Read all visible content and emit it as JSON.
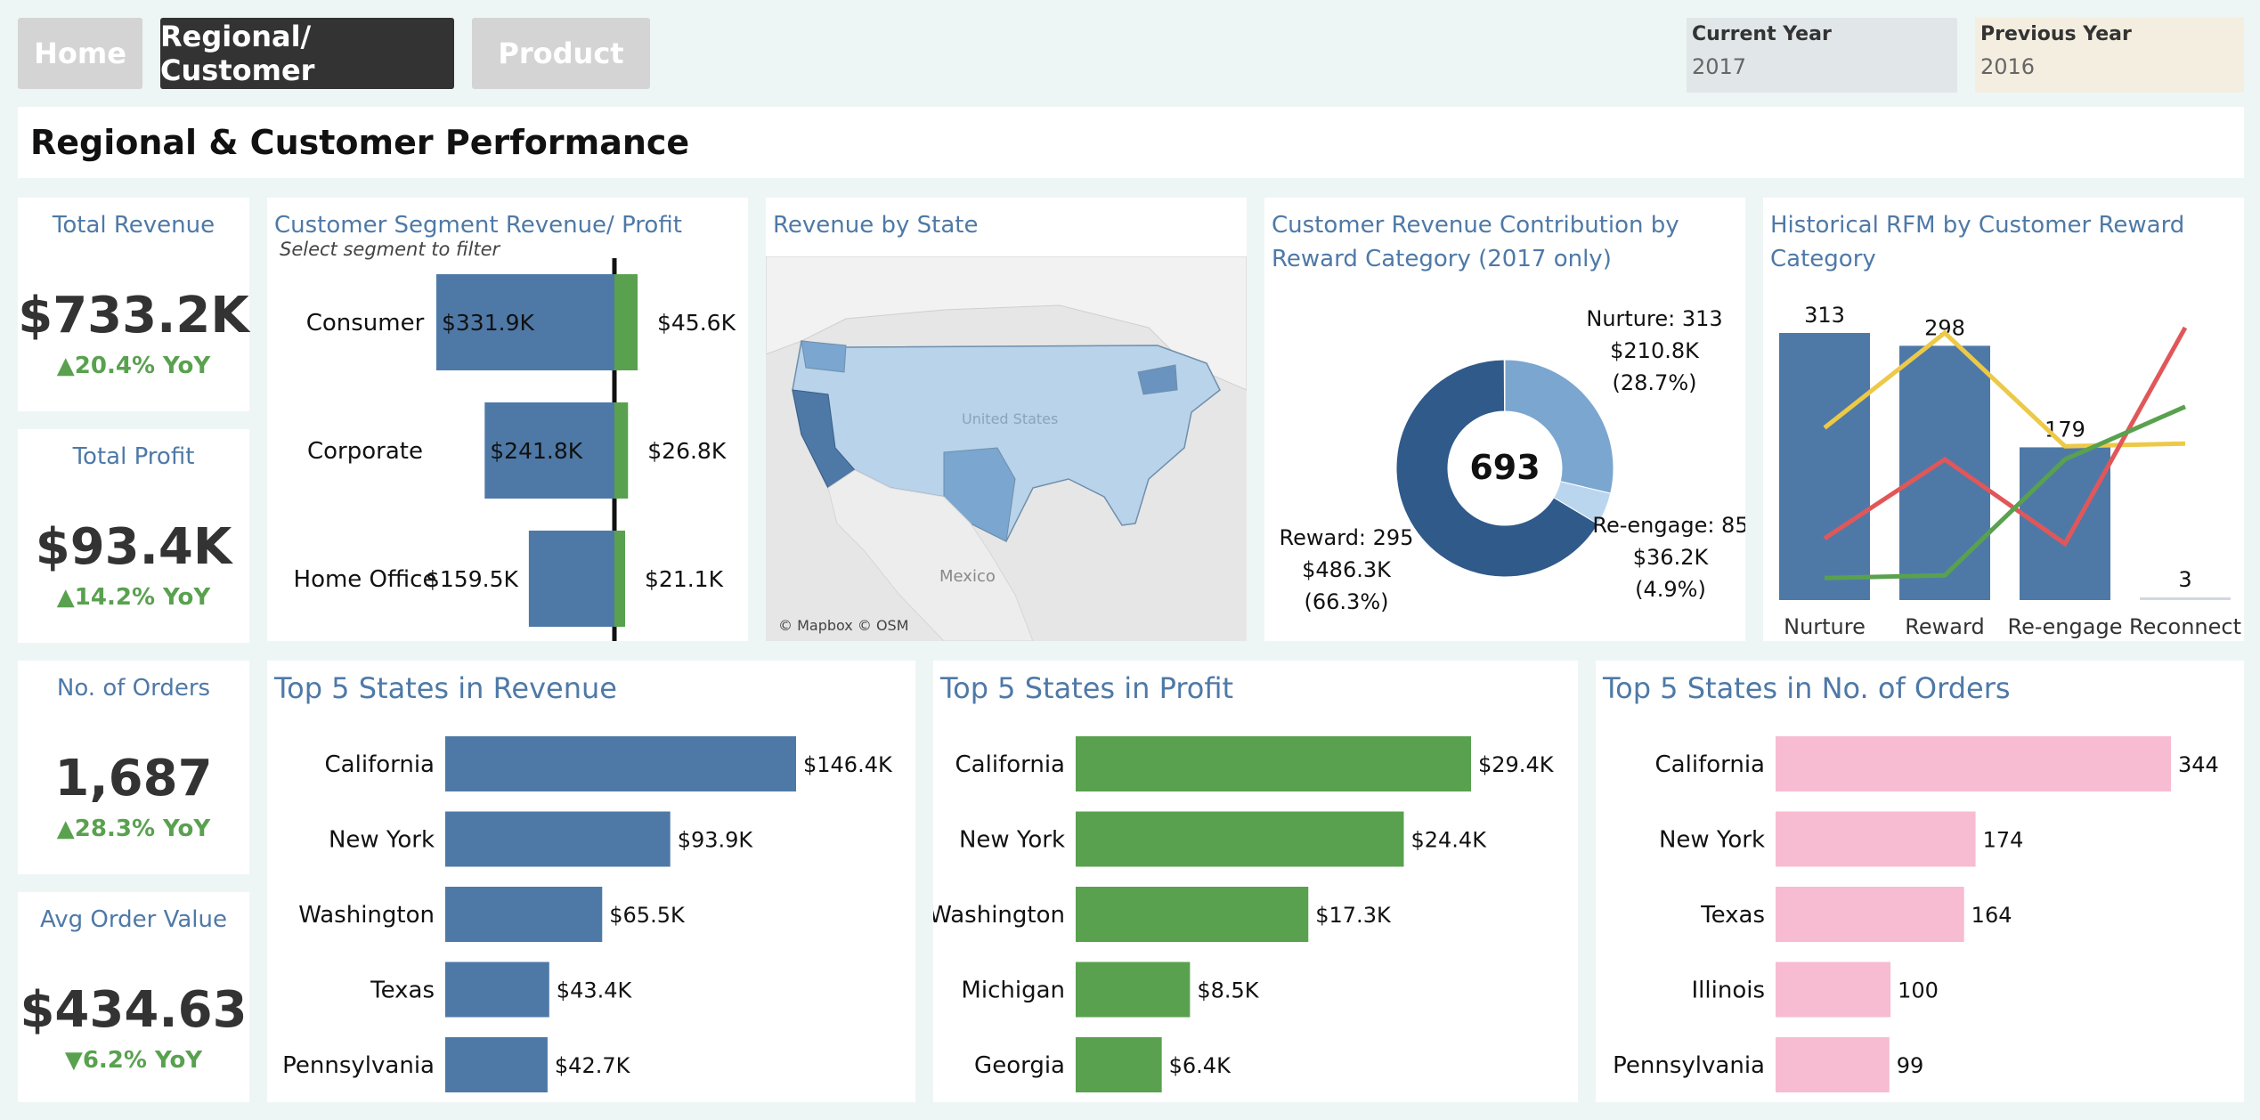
{
  "tabs": [
    {
      "label": "Home"
    },
    {
      "label": "Regional/ Customer"
    },
    {
      "label": "Product"
    }
  ],
  "filters": {
    "current_year": {
      "label": "Current Year",
      "value": "2017",
      "color": "#e1e6e8"
    },
    "previous_year": {
      "label": "Previous Year",
      "value": "2016",
      "color": "#f4eee0"
    }
  },
  "page_title": "Regional & Customer Performance",
  "kpis": {
    "revenue": {
      "title": "Total Revenue",
      "value": "$733.2K",
      "yoy": "▲20.4% YoY"
    },
    "profit": {
      "title": "Total Profit",
      "value": "$93.4K",
      "yoy": "▲14.2% YoY"
    },
    "orders": {
      "title": "No. of Orders",
      "value": "1,687",
      "yoy": "▲28.3% YoY"
    },
    "aov": {
      "title": "Avg Order Value",
      "value": "$434.63",
      "yoy": "▼6.2% YoY"
    }
  },
  "colors": {
    "blue": "#4e79a7",
    "green": "#59a14f",
    "pink": "#f7bcd1",
    "title_blue": "#4e79a7"
  },
  "segment": {
    "title": "Customer Segment Revenue/ Profit",
    "subtitle": "Select segment to filter",
    "rows": [
      {
        "name": "Consumer",
        "revenue_label": "$331.9K",
        "revenue": 331.9,
        "profit_label": "$45.6K",
        "profit": 45.6
      },
      {
        "name": "Corporate",
        "revenue_label": "$241.8K",
        "revenue": 241.8,
        "profit_label": "$26.8K",
        "profit": 26.8
      },
      {
        "name": "Home Office",
        "revenue_label": "$159.5K",
        "revenue": 159.5,
        "profit_label": "$21.1K",
        "profit": 21.1
      }
    ]
  },
  "map": {
    "title": "Revenue by State",
    "credit": "© Mapbox © OSM",
    "country_label": "Mexico",
    "us_label": "United States"
  },
  "donut": {
    "title_line1": "Customer Revenue Contribution by",
    "title_line2": "Reward Category (2017 only)",
    "center": "693",
    "slices": [
      {
        "name": "Nurture",
        "count": 313,
        "revenue": "$210.8K",
        "pct": 28.7,
        "pct_label": "(28.7%)",
        "label": "Nurture: 313",
        "color": "#7aa6d0"
      },
      {
        "name": "Re-engage",
        "count": 85,
        "revenue": "$36.2K",
        "pct": 4.9,
        "pct_label": "(4.9%)",
        "label": "Re-engage: 85",
        "color": "#b9d6ee"
      },
      {
        "name": "Reward",
        "count": 295,
        "revenue": "$486.3K",
        "pct": 66.3,
        "pct_label": "(66.3%)",
        "label": "Reward: 295",
        "color": "#2f5a8a"
      }
    ]
  },
  "rfm": {
    "title_line1": "Historical RFM by Customer Reward",
    "title_line2": "Category",
    "categories": [
      "Nurture",
      "Reward",
      "Re-engage",
      "Reconnect"
    ],
    "bars": [
      313,
      298,
      179,
      3
    ],
    "lines": [
      {
        "color": "#edc948",
        "values": [
          0.62,
          0.98,
          0.55,
          0.56
        ]
      },
      {
        "color": "#e15759",
        "values": [
          0.2,
          0.5,
          0.18,
          1.0
        ]
      },
      {
        "color": "#59a14f",
        "values": [
          0.05,
          0.06,
          0.5,
          0.7
        ]
      }
    ]
  },
  "top_revenue": {
    "title": "Top 5 States in Revenue",
    "rows": [
      {
        "state": "California",
        "value": 146.4,
        "label": "$146.4K"
      },
      {
        "state": "New York",
        "value": 93.9,
        "label": "$93.9K"
      },
      {
        "state": "Washington",
        "value": 65.5,
        "label": "$65.5K"
      },
      {
        "state": "Texas",
        "value": 43.4,
        "label": "$43.4K"
      },
      {
        "state": "Pennsylvania",
        "value": 42.7,
        "label": "$42.7K"
      }
    ]
  },
  "top_profit": {
    "title": "Top 5 States in Profit",
    "rows": [
      {
        "state": "California",
        "value": 29.4,
        "label": "$29.4K"
      },
      {
        "state": "New York",
        "value": 24.4,
        "label": "$24.4K"
      },
      {
        "state": "Washington",
        "value": 17.3,
        "label": "$17.3K"
      },
      {
        "state": "Michigan",
        "value": 8.5,
        "label": "$8.5K"
      },
      {
        "state": "Georgia",
        "value": 6.4,
        "label": "$6.4K"
      }
    ]
  },
  "top_orders": {
    "title": "Top 5 States in No. of Orders",
    "rows": [
      {
        "state": "California",
        "value": 344,
        "label": "344"
      },
      {
        "state": "New York",
        "value": 174,
        "label": "174"
      },
      {
        "state": "Texas",
        "value": 164,
        "label": "164"
      },
      {
        "state": "Illinois",
        "value": 100,
        "label": "100"
      },
      {
        "state": "Pennsylvania",
        "value": 99,
        "label": "99"
      }
    ]
  },
  "chart_data": [
    {
      "type": "bar",
      "title": "Customer Segment Revenue/ Profit",
      "categories": [
        "Consumer",
        "Corporate",
        "Home Office"
      ],
      "series": [
        {
          "name": "Revenue",
          "values": [
            331.9,
            241.8,
            159.5
          ]
        },
        {
          "name": "Profit",
          "values": [
            45.6,
            26.8,
            21.1
          ]
        }
      ]
    },
    {
      "type": "pie",
      "title": "Customer Revenue Contribution by Reward Category (2017 only)",
      "categories": [
        "Nurture",
        "Re-engage",
        "Reward"
      ],
      "values": [
        28.7,
        4.9,
        66.3
      ]
    },
    {
      "type": "bar",
      "title": "Historical RFM by Customer Reward Category",
      "categories": [
        "Nurture",
        "Reward",
        "Re-engage",
        "Reconnect"
      ],
      "values": [
        313,
        298,
        179,
        3
      ]
    },
    {
      "type": "bar",
      "title": "Top 5 States in Revenue",
      "categories": [
        "California",
        "New York",
        "Washington",
        "Texas",
        "Pennsylvania"
      ],
      "values": [
        146.4,
        93.9,
        65.5,
        43.4,
        42.7
      ]
    },
    {
      "type": "bar",
      "title": "Top 5 States in Profit",
      "categories": [
        "California",
        "New York",
        "Washington",
        "Michigan",
        "Georgia"
      ],
      "values": [
        29.4,
        24.4,
        17.3,
        8.5,
        6.4
      ]
    },
    {
      "type": "bar",
      "title": "Top 5 States in No. of Orders",
      "categories": [
        "California",
        "New York",
        "Texas",
        "Illinois",
        "Pennsylvania"
      ],
      "values": [
        344,
        174,
        164,
        100,
        99
      ]
    }
  ]
}
